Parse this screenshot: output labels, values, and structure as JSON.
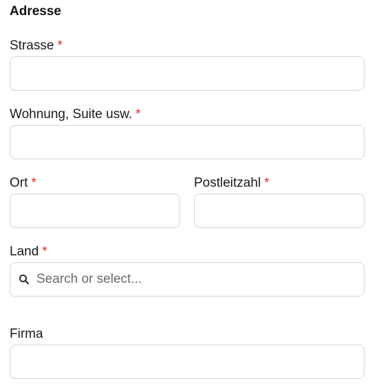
{
  "section": {
    "title": "Adresse"
  },
  "fields": {
    "street": {
      "label": "Strasse",
      "required_mark": "*",
      "value": ""
    },
    "apartment": {
      "label": "Wohnung, Suite usw.",
      "required_mark": "*",
      "value": ""
    },
    "city": {
      "label": "Ort",
      "required_mark": "*",
      "value": ""
    },
    "postal": {
      "label": "Postleitzahl",
      "required_mark": "*",
      "value": ""
    },
    "country": {
      "label": "Land",
      "required_mark": "*",
      "placeholder": "Search or select..."
    },
    "company": {
      "label": "Firma",
      "value": ""
    }
  },
  "icons": {
    "country_search": "search-icon"
  },
  "colors": {
    "required": "#d92d2d",
    "border": "#d4d4d4",
    "placeholder": "#6b6b6b"
  }
}
